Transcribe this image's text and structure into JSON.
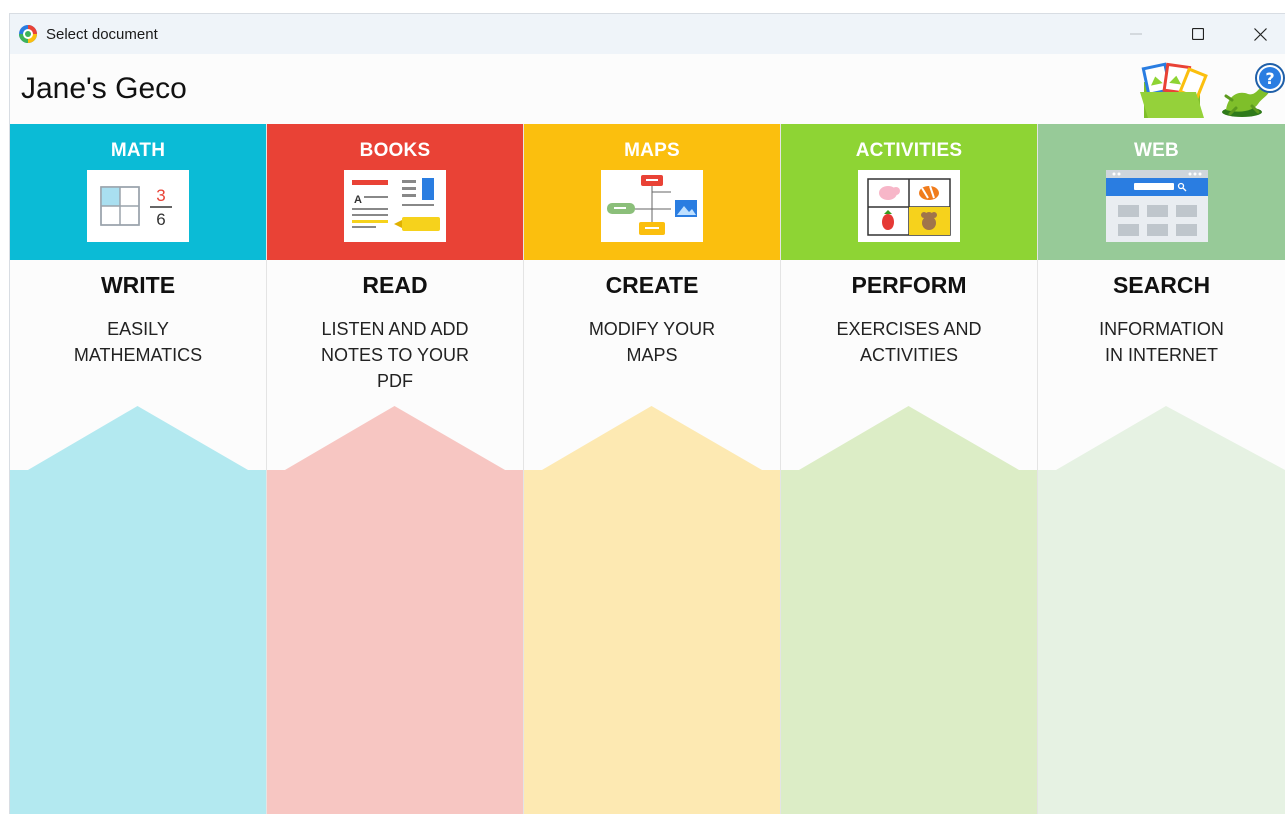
{
  "window": {
    "title": "Select document",
    "buttons": {
      "minimize": "minimize-icon",
      "maximize": "maximize-icon",
      "close": "close-icon"
    }
  },
  "header": {
    "user_name": "Jane's Geco",
    "icons": [
      "documents-folder-icon",
      "help-gecko-icon"
    ]
  },
  "categories": [
    {
      "label": "MATH",
      "action": "WRITE",
      "desc_lines": [
        "EASILY",
        "MATHEMATICS"
      ],
      "color": "#0bbbd6",
      "pale": "#b3e9f0",
      "icon": "math-table-fraction-icon"
    },
    {
      "label": "BOOKS",
      "action": "READ",
      "desc_lines": [
        "LISTEN AND ADD",
        "NOTES TO YOUR",
        "PDF"
      ],
      "color": "#e94236",
      "pale": "#f7c6c2",
      "icon": "book-page-highlight-icon"
    },
    {
      "label": "MAPS",
      "action": "CREATE",
      "desc_lines": [
        "MODIFY YOUR",
        "MAPS"
      ],
      "color": "#fbbf0e",
      "pale": "#fde9b2",
      "icon": "concept-map-icon"
    },
    {
      "label": "ACTIVITIES",
      "action": "PERFORM",
      "desc_lines": [
        "EXERCISES AND",
        "ACTIVITIES"
      ],
      "color": "#8ed434",
      "pale": "#dcedc6",
      "icon": "activity-grid-icon"
    },
    {
      "label": "WEB",
      "action": "SEARCH",
      "desc_lines": [
        "INFORMATION",
        "IN INTERNET"
      ],
      "color": "#97ca98",
      "pale": "#e6f2e3",
      "icon": "browser-window-icon"
    }
  ],
  "thumb_texts": {
    "math_numerator": "3",
    "math_denominator": "6",
    "books_letter": "A"
  }
}
